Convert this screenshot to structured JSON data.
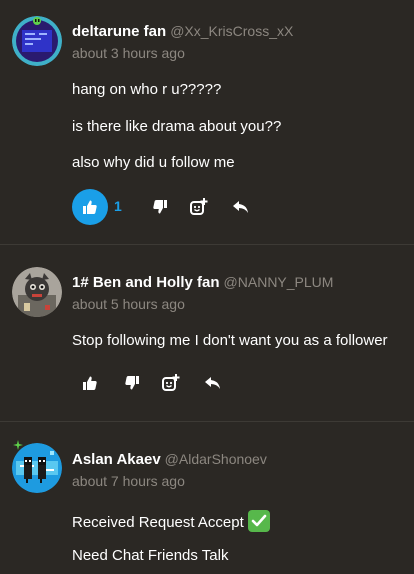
{
  "comments": [
    {
      "display_name": "deltarune fan",
      "handle": "@Xx_KrisCross_xX",
      "time": "about 3 hours ago",
      "lines": [
        "hang on who r u?????",
        "is there like drama about you??",
        "also why did u follow me"
      ],
      "likes": "1",
      "liked": true,
      "avatar_icon": "deltarune-avatar"
    },
    {
      "display_name": "1# Ben and Holly fan",
      "handle": "@NANNY_PLUM",
      "time": "about 5 hours ago",
      "lines": [
        "Stop following me I don't want you as a follower"
      ],
      "likes": "",
      "liked": false,
      "avatar_icon": "character-avatar"
    },
    {
      "display_name": "Aslan Akaev",
      "handle": "@AldarShonoev",
      "time": "about 7 hours ago",
      "lines": [
        "Received Request Accept",
        "Need Chat Friends Talk"
      ],
      "line_emoji": "check-mark-button-emoji",
      "avatar_icon": "pixel-characters-avatar"
    }
  ],
  "colors": {
    "background": "#2b2824",
    "accent_blue": "#1a9fe8",
    "muted_text": "#8c8780",
    "divider": "#3d3a35"
  },
  "icons": {
    "like": "thumbs-up-icon",
    "dislike": "thumbs-down-icon",
    "react": "add-emoji-icon",
    "reply": "reply-arrow-icon"
  }
}
